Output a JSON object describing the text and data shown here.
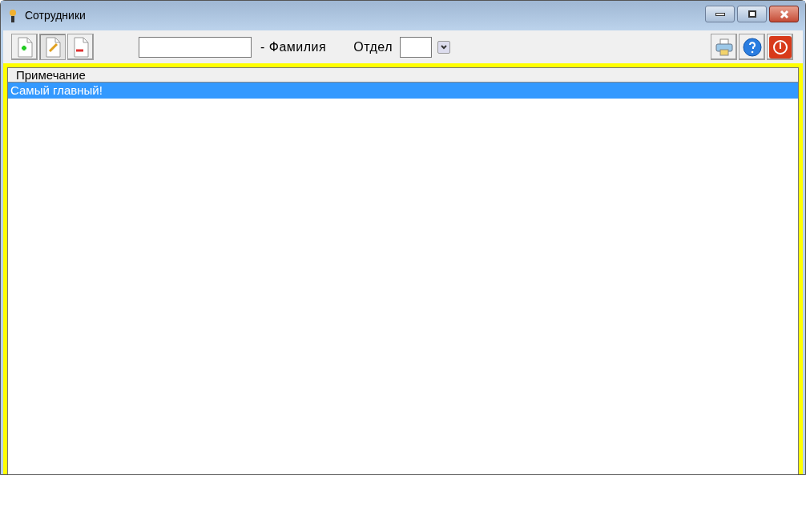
{
  "window": {
    "title": "Сотрудники"
  },
  "search": {
    "label": "- Фамилия"
  },
  "department": {
    "label": "Отдел"
  },
  "table": {
    "columns": [
      "Примечание"
    ],
    "rows": [
      {
        "cells": [
          "Самый главный!"
        ],
        "selected": true
      }
    ]
  }
}
